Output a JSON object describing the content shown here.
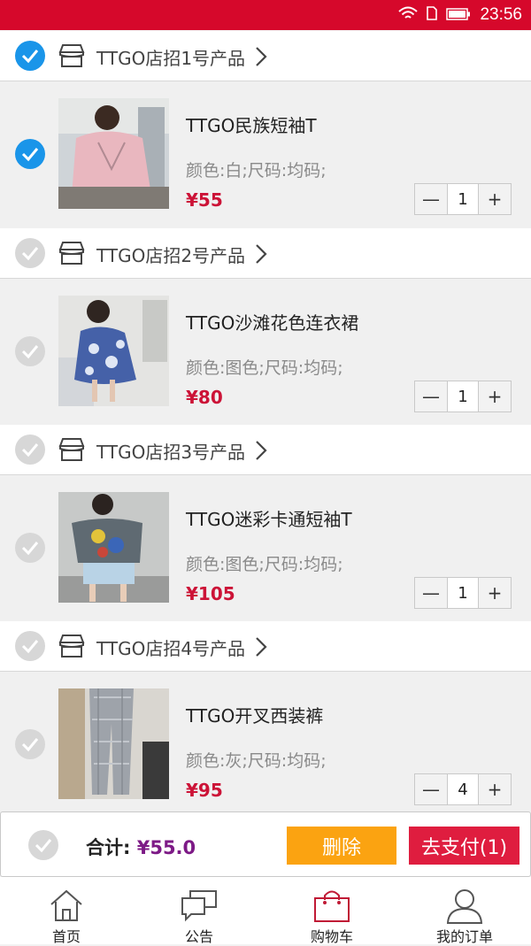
{
  "status_bar": {
    "time": "23:56",
    "icons": [
      "wifi-icon",
      "sim-icon",
      "battery-icon"
    ]
  },
  "colors": {
    "brand": "#d6082b",
    "checked": "#1a95e9",
    "unchecked": "#d7d7d7",
    "price": "#cc1337",
    "delete": "#fba311",
    "pay": "#df1d3f",
    "total": "#7d1a86"
  },
  "shops": [
    {
      "name": "TTGO店招1号产品",
      "checked": true,
      "product": {
        "name": "TTGO民族短袖T",
        "spec": "颜色:白;尺码:均码;",
        "price": "¥55",
        "qty": "1",
        "checked": true
      }
    },
    {
      "name": "TTGO店招2号产品",
      "checked": false,
      "product": {
        "name": "TTGO沙滩花色连衣裙",
        "spec": "颜色:图色;尺码:均码;",
        "price": "¥80",
        "qty": "1",
        "checked": false
      }
    },
    {
      "name": "TTGO店招3号产品",
      "checked": false,
      "product": {
        "name": "TTGO迷彩卡通短袖T",
        "spec": "颜色:图色;尺码:均码;",
        "price": "¥105",
        "qty": "1",
        "checked": false
      }
    },
    {
      "name": "TTGO店招4号产品",
      "checked": false,
      "product": {
        "name": "TTGO开叉西装裤",
        "spec": "颜色:灰;尺码:均码;",
        "price": "¥95",
        "qty": "4",
        "checked": false
      }
    }
  ],
  "stepper": {
    "minus": "—",
    "plus": "+"
  },
  "footer": {
    "total_label": "合计:",
    "total_amount": "¥55.0",
    "delete_label": "删除",
    "pay_label": "去支付(1)"
  },
  "nav": [
    {
      "label": "首页",
      "icon": "home-icon"
    },
    {
      "label": "公告",
      "icon": "chat-bubble-icon"
    },
    {
      "label": "购物车",
      "icon": "shopping-bag-icon"
    },
    {
      "label": "我的订单",
      "icon": "user-icon"
    }
  ]
}
